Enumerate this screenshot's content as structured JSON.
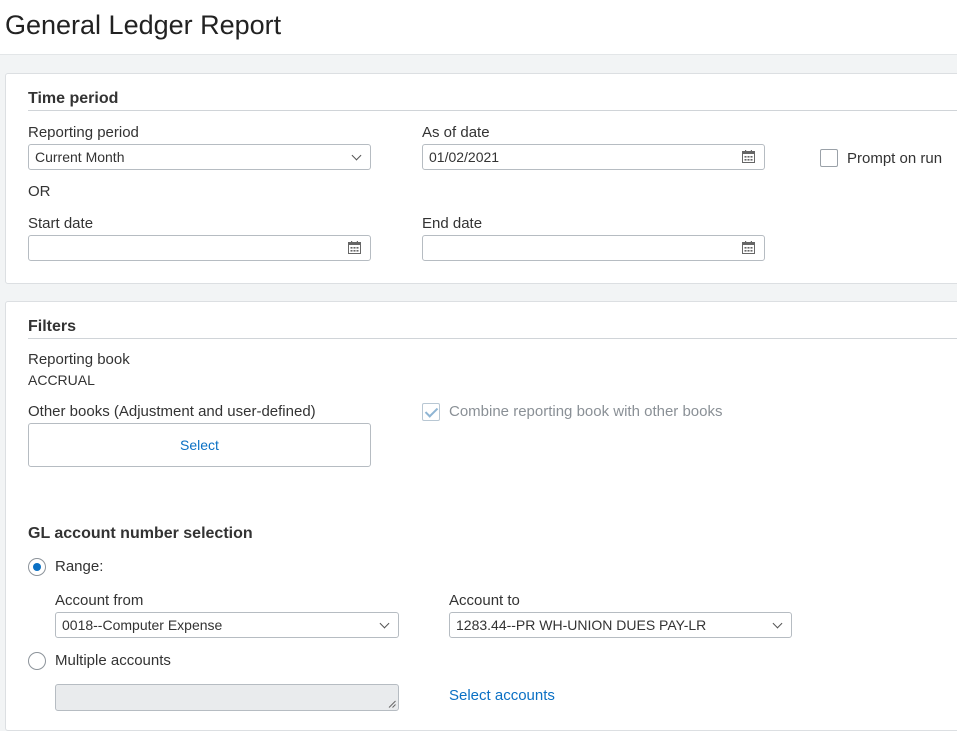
{
  "page": {
    "title": "General Ledger Report"
  },
  "time_period": {
    "section_title": "Time period",
    "reporting_period_label": "Reporting period",
    "reporting_period_value": "Current Month",
    "as_of_date_label": "As of date",
    "as_of_date_value": "01/02/2021",
    "prompt_on_run_label": "Prompt on run",
    "or_label": "OR",
    "start_date_label": "Start date",
    "start_date_value": "",
    "end_date_label": "End date",
    "end_date_value": ""
  },
  "filters": {
    "section_title": "Filters",
    "reporting_book_label": "Reporting book",
    "reporting_book_value": "ACCRUAL",
    "other_books_label": "Other books (Adjustment and user-defined)",
    "select_label": "Select",
    "combine_label": "Combine reporting book with other books",
    "gl_selection_title": "GL account number selection",
    "range_label": "Range:",
    "account_from_label": "Account from",
    "account_from_value": "0018--Computer Expense",
    "account_to_label": "Account to",
    "account_to_value": "1283.44--PR WH-UNION DUES PAY-LR",
    "multiple_accounts_label": "Multiple accounts",
    "select_accounts_label": "Select accounts"
  },
  "colors": {
    "accent": "#0a70c4",
    "border": "#b6bcc2",
    "background": "#f2f4f5"
  },
  "icons": [
    "calendar-icon",
    "chevron-down-icon",
    "check-icon",
    "resize-grip-icon"
  ]
}
